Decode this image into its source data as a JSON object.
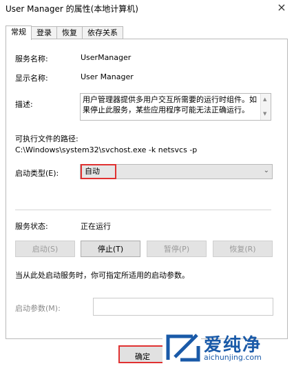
{
  "window": {
    "title": "User Manager 的属性(本地计算机)",
    "close_label": "×"
  },
  "tabs": [
    {
      "label": "常规",
      "active": true
    },
    {
      "label": "登录",
      "active": false
    },
    {
      "label": "恢复",
      "active": false
    },
    {
      "label": "依存关系",
      "active": false
    }
  ],
  "general": {
    "service_name_label": "服务名称:",
    "service_name_value": "UserManager",
    "display_name_label": "显示名称:",
    "display_name_value": "User Manager",
    "description_label": "描述:",
    "description_value": "用户管理器提供多用户交互所需要的运行时组件。如果停止此服务，某些应用程序可能无法正确运行。",
    "exe_path_label": "可执行文件的路径:",
    "exe_path_value": "C:\\Windows\\system32\\svchost.exe -k netsvcs -p",
    "startup_type_label": "启动类型(E):",
    "startup_type_value": "自动",
    "status_label": "服务状态:",
    "status_value": "正在运行"
  },
  "buttons": {
    "start": "启动(S)",
    "stop": "停止(T)",
    "pause": "暂停(P)",
    "resume": "恢复(R)"
  },
  "hint": "当从此处启动服务时，你可指定所适用的启动参数。",
  "params_label": "启动参数(M):",
  "ok_label": "确定",
  "watermark": {
    "name": "爱纯净",
    "url": "aichunjing.com"
  },
  "colors": {
    "highlight": "#e03030",
    "watermark": "#1a5aa8"
  }
}
